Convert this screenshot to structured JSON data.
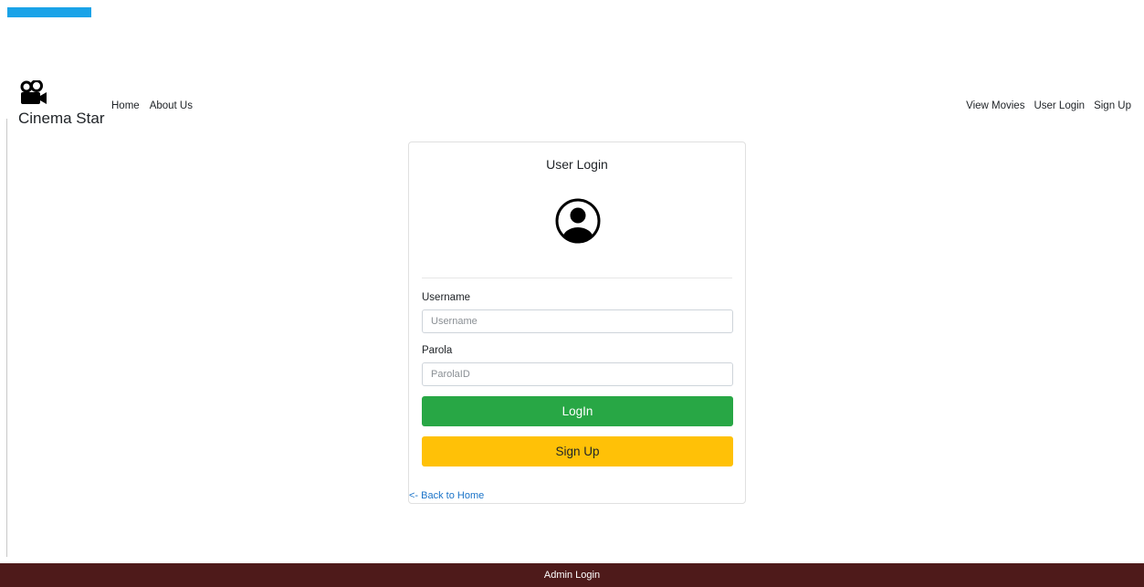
{
  "brand": {
    "name": "Cinema Star",
    "icon": "movie-camera-icon"
  },
  "nav_left": [
    {
      "label": "Home"
    },
    {
      "label": "About Us"
    }
  ],
  "nav_right": [
    {
      "label": "View Movies"
    },
    {
      "label": "User Login"
    },
    {
      "label": "Sign Up"
    }
  ],
  "login_card": {
    "title": "User Login",
    "icon": "user-circle-icon",
    "username": {
      "label": "Username",
      "placeholder": "Username",
      "value": ""
    },
    "password": {
      "label": "Parola",
      "placeholder": "ParolaID",
      "value": ""
    },
    "login_button": "LogIn",
    "signup_button": "Sign Up",
    "back_link": "<- Back to Home"
  },
  "footer": {
    "admin_link": "Admin Login"
  },
  "colors": {
    "top_accent": "#1aa3e8",
    "login_button": "#28a745",
    "signup_button": "#ffc107",
    "footer_bg": "#4e1a1a",
    "link": "#1a73c8"
  }
}
